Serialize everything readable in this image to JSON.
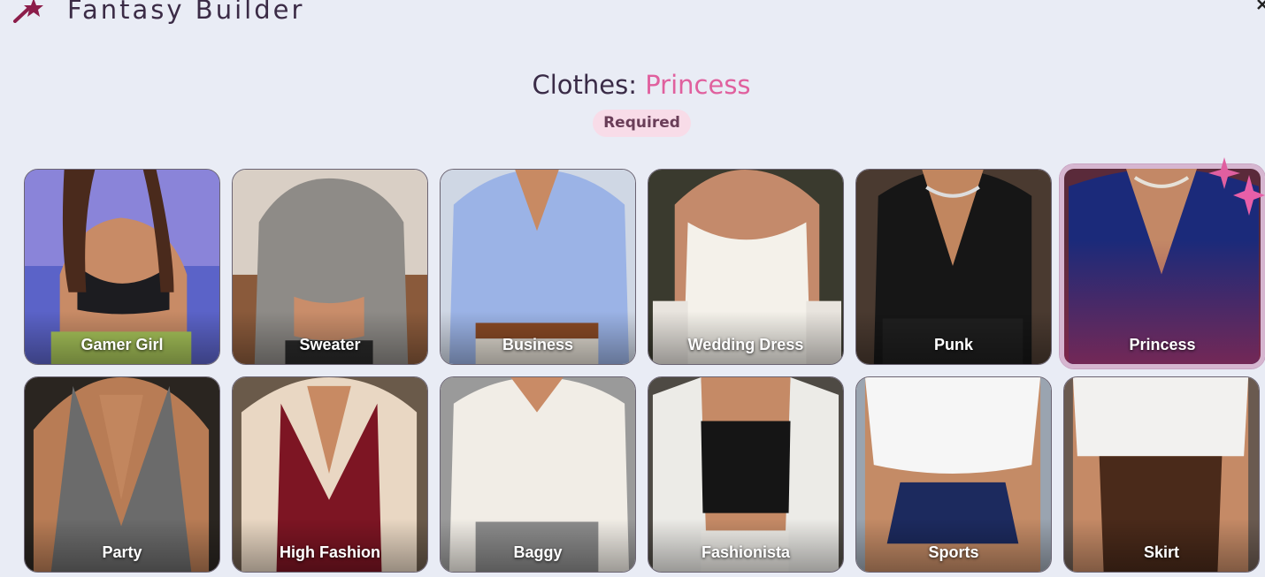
{
  "header": {
    "app_title": "Fantasy Builder",
    "logo_icon": "magic-wand-icon",
    "close_icon": "close-icon"
  },
  "section": {
    "label": "Clothes:",
    "selected_value": "Princess",
    "badge": "Required"
  },
  "colors": {
    "background": "#e9ecf5",
    "accent": "#e0609e",
    "badge_bg": "#f8dce8",
    "selected_border": "#d6b6d0"
  },
  "options": [
    {
      "label": "Gamer Girl",
      "selected": false
    },
    {
      "label": "Sweater",
      "selected": false
    },
    {
      "label": "Business",
      "selected": false
    },
    {
      "label": "Wedding Dress",
      "selected": false
    },
    {
      "label": "Punk",
      "selected": false
    },
    {
      "label": "Princess",
      "selected": true
    },
    {
      "label": "Party",
      "selected": false
    },
    {
      "label": "High Fashion",
      "selected": false
    },
    {
      "label": "Baggy",
      "selected": false
    },
    {
      "label": "Fashionista",
      "selected": false
    },
    {
      "label": "Sports",
      "selected": false
    },
    {
      "label": "Skirt",
      "selected": false
    }
  ]
}
